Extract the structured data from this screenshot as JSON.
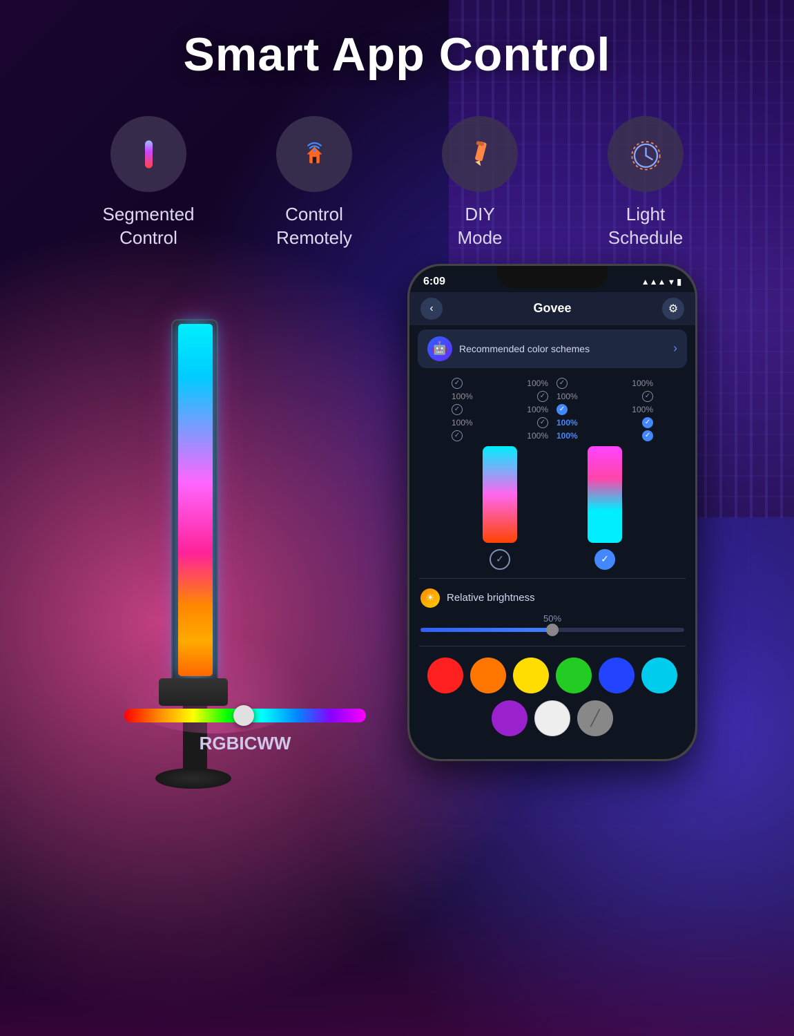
{
  "page": {
    "title": "Smart App Control",
    "features": [
      {
        "id": "segmented",
        "label": "Segmented\nControl",
        "label_line1": "Segmented",
        "label_line2": "Control",
        "icon": "bars"
      },
      {
        "id": "remote",
        "label": "Control\nRemotely",
        "label_line1": "Control",
        "label_line2": "Remotely",
        "icon": "wifi"
      },
      {
        "id": "diy",
        "label": "DIY\nMode",
        "label_line1": "DIY",
        "label_line2": "Mode",
        "icon": "pencil"
      },
      {
        "id": "schedule",
        "label": "Light\nSchedule",
        "label_line1": "Light",
        "label_line2": "Schedule",
        "icon": "clock"
      }
    ]
  },
  "slider": {
    "label": "RGBICWW"
  },
  "phone": {
    "time": "6:09",
    "app_name": "Govee",
    "back_label": "‹",
    "settings_icon": "⚙",
    "ai_text": "Recommended color schemes",
    "brightness_title": "Relative brightness",
    "brightness_pct": "50%",
    "bars": [
      {
        "position": "left",
        "colors": "left"
      },
      {
        "position": "right",
        "colors": "right"
      }
    ],
    "scheme_rows_left": [
      {
        "pct": "100%",
        "checked": false
      },
      {
        "pct": "100%",
        "checked": false
      },
      {
        "pct": "100%",
        "checked": false
      },
      {
        "pct": "100%",
        "checked": false
      },
      {
        "pct": "100%",
        "checked": false
      }
    ],
    "scheme_rows_right": [
      {
        "pct": "100%",
        "checked": false
      },
      {
        "pct": "100%",
        "checked": false
      },
      {
        "pct": "100%",
        "checked": false
      },
      {
        "pct": "100%",
        "highlight": true,
        "checked": true
      },
      {
        "pct": "100%",
        "highlight": true,
        "checked": true
      }
    ],
    "swatches": [
      "red",
      "orange",
      "yellow",
      "green",
      "blue",
      "cyan",
      "purple",
      "white",
      "cross"
    ]
  }
}
